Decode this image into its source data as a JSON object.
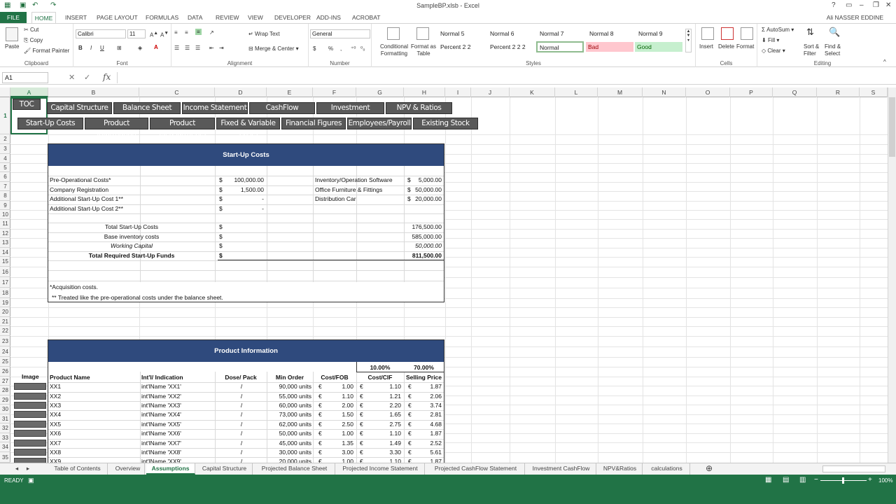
{
  "window": {
    "title": "SampleBP.xlsb - Excel",
    "user": "Ali NASSER EDDINE"
  },
  "ribbon_tabs": [
    "FILE",
    "HOME",
    "INSERT",
    "PAGE LAYOUT",
    "FORMULAS",
    "DATA",
    "REVIEW",
    "VIEW",
    "DEVELOPER",
    "ADD-INS",
    "ACROBAT"
  ],
  "ribbon": {
    "clipboard": {
      "paste": "Paste",
      "cut": "Cut",
      "copy": "Copy",
      "format_painter": "Format Painter",
      "label": "Clipboard"
    },
    "font": {
      "name": "Calibri",
      "size": "11",
      "label": "Font",
      "bold": "B",
      "italic": "I",
      "underline": "U"
    },
    "alignment": {
      "wrap": "Wrap Text",
      "merge": "Merge & Center",
      "label": "Alignment"
    },
    "number": {
      "format": "General",
      "currency": "$",
      "percent": "%",
      "comma": ",",
      "label": "Number"
    },
    "styles": {
      "conditional": "Conditional Formatting",
      "format_table": "Format as Table",
      "label": "Styles",
      "boxes": [
        {
          "t": "Normal 5"
        },
        {
          "t": "Normal 6"
        },
        {
          "t": "Normal 7"
        },
        {
          "t": "Normal 8"
        },
        {
          "t": "Normal 9"
        },
        {
          "t": "Percent 2 2"
        },
        {
          "t": "Percent 2 2 2"
        },
        {
          "t": "Normal"
        },
        {
          "t": "Bad"
        },
        {
          "t": "Good"
        }
      ]
    },
    "cells": {
      "insert": "Insert",
      "delete": "Delete",
      "format": "Format",
      "label": "Cells"
    },
    "editing": {
      "autosum": "AutoSum",
      "fill": "Fill",
      "clear": "Clear",
      "sort": "Sort & Filter",
      "find": "Find & Select",
      "label": "Editing"
    }
  },
  "formula_bar": {
    "name_box": "A1",
    "fx": "fx",
    "value": ""
  },
  "columns": [
    "A",
    "B",
    "C",
    "D",
    "E",
    "F",
    "G",
    "H",
    "I",
    "J",
    "K",
    "L",
    "M",
    "N",
    "O",
    "P",
    "Q",
    "R",
    "S"
  ],
  "rows": [
    "1",
    "2",
    "3",
    "4",
    "5",
    "6",
    "7",
    "8",
    "9",
    "10",
    "11",
    "12",
    "13",
    "14",
    "15",
    "16",
    "17",
    "18",
    "19",
    "20",
    "21",
    "22",
    "23",
    "24",
    "25",
    "26",
    "27",
    "28",
    "29",
    "30",
    "31",
    "32",
    "33",
    "34",
    "35"
  ],
  "nav": {
    "toc": "TOC",
    "row1": [
      "Capital Structure",
      "Balance Sheet",
      "Income Statement",
      "CashFlow Statement",
      "Investment Cashflow",
      "NPV & Ratios"
    ],
    "row2": [
      "Start-Up Costs",
      "Product Information",
      "Product Measurments",
      "Fixed & Variable Costs",
      "Financial Figures",
      "Employees/Payroll",
      "Existing Stock"
    ]
  },
  "startup": {
    "title": "Start-Up Costs",
    "items": [
      {
        "label": "Pre-Operational Costs*",
        "cur": "$",
        "val": "100,000.00"
      },
      {
        "label": "Company Registration",
        "cur": "$",
        "val": "1,500.00"
      },
      {
        "label": "Additional Start-Up Cost 1**",
        "cur": "$",
        "val": "-"
      },
      {
        "label": "Additional Start-Up Cost 2**",
        "cur": "$",
        "val": "-"
      }
    ],
    "right_items": [
      {
        "label": "Inventory/Operation Software",
        "cur": "$",
        "val": "5,000.00"
      },
      {
        "label": "Office Furniture & Fittings",
        "cur": "$",
        "val": "50,000.00"
      },
      {
        "label": "Distribution Car",
        "cur": "$",
        "val": "20,000.00"
      }
    ],
    "totals": [
      {
        "label": "Total Start-Up Costs",
        "cur": "$",
        "val": "176,500.00"
      },
      {
        "label": "Base inventory costs",
        "cur": "$",
        "val": "585,000.00"
      },
      {
        "label": "Working Capital",
        "cur": "$",
        "val": "50,000.00"
      },
      {
        "label": "Total Required Start-Up Funds",
        "cur": "$",
        "val": "811,500.00"
      }
    ],
    "note1": "*Acquisition costs.",
    "note2": "** Treated like the pre-operational costs under the balance sheet."
  },
  "product": {
    "title": "Product Information",
    "pct1": "10.00%",
    "pct2": "70.00%",
    "image_header": "Image",
    "headers": [
      "Product Name",
      "Int'l/ Indication",
      "Dose/ Pack",
      "Min Order",
      "Cost/FOB",
      "Cost/CIF",
      "Selling Price"
    ],
    "rows": [
      {
        "name": "XX1",
        "intl": "int'lName 'XX1'",
        "dose": "/",
        "min": "90,000 units",
        "fob": "1.00",
        "cif": "1.10",
        "sell": "1.87"
      },
      {
        "name": "XX2",
        "intl": "int'lName 'XX2'",
        "dose": "/",
        "min": "55,000 units",
        "fob": "1.10",
        "cif": "1.21",
        "sell": "2.06"
      },
      {
        "name": "XX3",
        "intl": "int'lName 'XX3'",
        "dose": "/",
        "min": "60,000 units",
        "fob": "2.00",
        "cif": "2.20",
        "sell": "3.74"
      },
      {
        "name": "XX4",
        "intl": "int'lName 'XX4'",
        "dose": "/",
        "min": "73,000 units",
        "fob": "1.50",
        "cif": "1.65",
        "sell": "2.81"
      },
      {
        "name": "XX5",
        "intl": "int'lName 'XX5'",
        "dose": "/",
        "min": "62,000 units",
        "fob": "2.50",
        "cif": "2.75",
        "sell": "4.68"
      },
      {
        "name": "XX6",
        "intl": "int'lName 'XX6'",
        "dose": "/",
        "min": "50,000 units",
        "fob": "1.00",
        "cif": "1.10",
        "sell": "1.87"
      },
      {
        "name": "XX7",
        "intl": "int'lName 'XX7'",
        "dose": "/",
        "min": "45,000 units",
        "fob": "1.35",
        "cif": "1.49",
        "sell": "2.52"
      },
      {
        "name": "XX8",
        "intl": "int'lName 'XX8'",
        "dose": "/",
        "min": "30,000 units",
        "fob": "3.00",
        "cif": "3.30",
        "sell": "5.61"
      },
      {
        "name": "XX9",
        "intl": "int'lName 'XX9'",
        "dose": "/",
        "min": "20,000 units",
        "fob": "1.00",
        "cif": "1.10",
        "sell": "1.87"
      }
    ],
    "euro": "€"
  },
  "sheet_tabs": [
    "Table of Contents",
    "Overview",
    "Assumptions",
    "Capital Structure",
    "Projected Balance Sheet",
    "Projected Income Statement",
    "Projected CashFlow Statement",
    "Investment CashFlow",
    "NPV&Ratios",
    "calculations"
  ],
  "active_sheet": "Assumptions",
  "status": {
    "ready": "READY",
    "zoom": "100%"
  }
}
